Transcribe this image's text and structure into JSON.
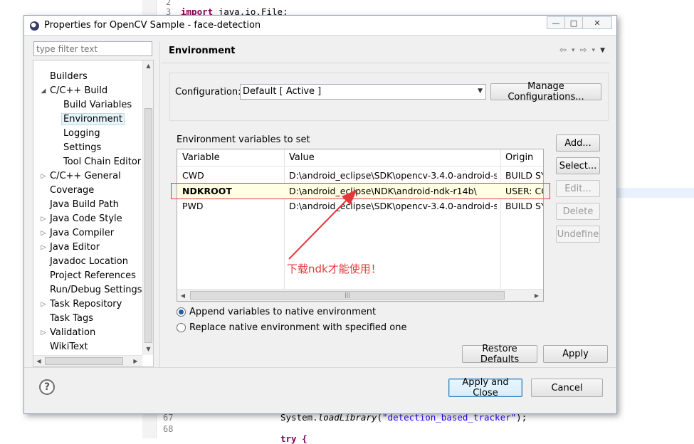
{
  "window": {
    "title": "Properties for OpenCV Sample - face-detection",
    "minimize": "—",
    "maximize": "□",
    "close": "✕"
  },
  "editor": {
    "line_top": "2",
    "line_import": "3",
    "import_kw": "import",
    "import_text": " java.io.File;",
    "line_67": "67",
    "line_68": "68",
    "code_67_prefix": "System.",
    "code_67_method": "loadLibrary",
    "code_67_string": "\"detection_based_tracker\"",
    "code_67_suffix": ");",
    "code_69": "try {"
  },
  "tree": {
    "filter_placeholder": "type filter text",
    "items": [
      {
        "label": "Builders",
        "level": 1,
        "toggle": ""
      },
      {
        "label": "C/C++ Build",
        "level": 1,
        "toggle": "◢"
      },
      {
        "label": "Build Variables",
        "level": 2,
        "toggle": ""
      },
      {
        "label": "Environment",
        "level": 2,
        "toggle": "",
        "selected": true
      },
      {
        "label": "Logging",
        "level": 2,
        "toggle": ""
      },
      {
        "label": "Settings",
        "level": 2,
        "toggle": ""
      },
      {
        "label": "Tool Chain Editor",
        "level": 2,
        "toggle": ""
      },
      {
        "label": "C/C++ General",
        "level": 1,
        "toggle": "▷"
      },
      {
        "label": "Coverage",
        "level": 1,
        "toggle": ""
      },
      {
        "label": "Java Build Path",
        "level": 1,
        "toggle": ""
      },
      {
        "label": "Java Code Style",
        "level": 1,
        "toggle": "▷"
      },
      {
        "label": "Java Compiler",
        "level": 1,
        "toggle": "▷"
      },
      {
        "label": "Java Editor",
        "level": 1,
        "toggle": "▷"
      },
      {
        "label": "Javadoc Location",
        "level": 1,
        "toggle": ""
      },
      {
        "label": "Project References",
        "level": 1,
        "toggle": ""
      },
      {
        "label": "Run/Debug Settings",
        "level": 1,
        "toggle": ""
      },
      {
        "label": "Task Repository",
        "level": 1,
        "toggle": "▷"
      },
      {
        "label": "Task Tags",
        "level": 1,
        "toggle": ""
      },
      {
        "label": "Validation",
        "level": 1,
        "toggle": "▷"
      },
      {
        "label": "WikiText",
        "level": 1,
        "toggle": ""
      }
    ]
  },
  "panel": {
    "heading": "Environment",
    "nav": {
      "back": "⇦",
      "forward": "⇨",
      "dropdown": "▾",
      "menu": "▼"
    },
    "config_label": "Configuration:",
    "config_value": "Default  [ Active ]",
    "manage_button": "Manage Configurations...",
    "env_label": "Environment variables to set",
    "columns": [
      "Variable",
      "Value",
      "Origin"
    ],
    "rows": [
      {
        "variable": "CWD",
        "value": "D:\\android_eclipse\\SDK\\opencv-3.4.0-android-s...",
        "origin": "BUILD SY"
      },
      {
        "variable": "NDKROOT",
        "value": "D:\\android_eclipse\\NDK\\android-ndk-r14b\\",
        "origin": "USER: CC"
      },
      {
        "variable": "PWD",
        "value": "D:\\android_eclipse\\SDK\\opencv-3.4.0-android-s...",
        "origin": "BUILD SY"
      }
    ],
    "side_buttons": {
      "add": "Add...",
      "select": "Select...",
      "edit": "Edit...",
      "delete": "Delete",
      "undefine": "Undefine"
    },
    "annotation": "下载ndk才能使用！",
    "radio_append": "Append variables to native environment",
    "radio_replace": "Replace native environment with specified one",
    "restore_defaults": "Restore Defaults",
    "apply": "Apply"
  },
  "footer": {
    "help": "?",
    "apply_close": "Apply and Close",
    "cancel": "Cancel"
  },
  "colors": {
    "annotation": "#e4393c",
    "selection": "#e5f3fb"
  }
}
